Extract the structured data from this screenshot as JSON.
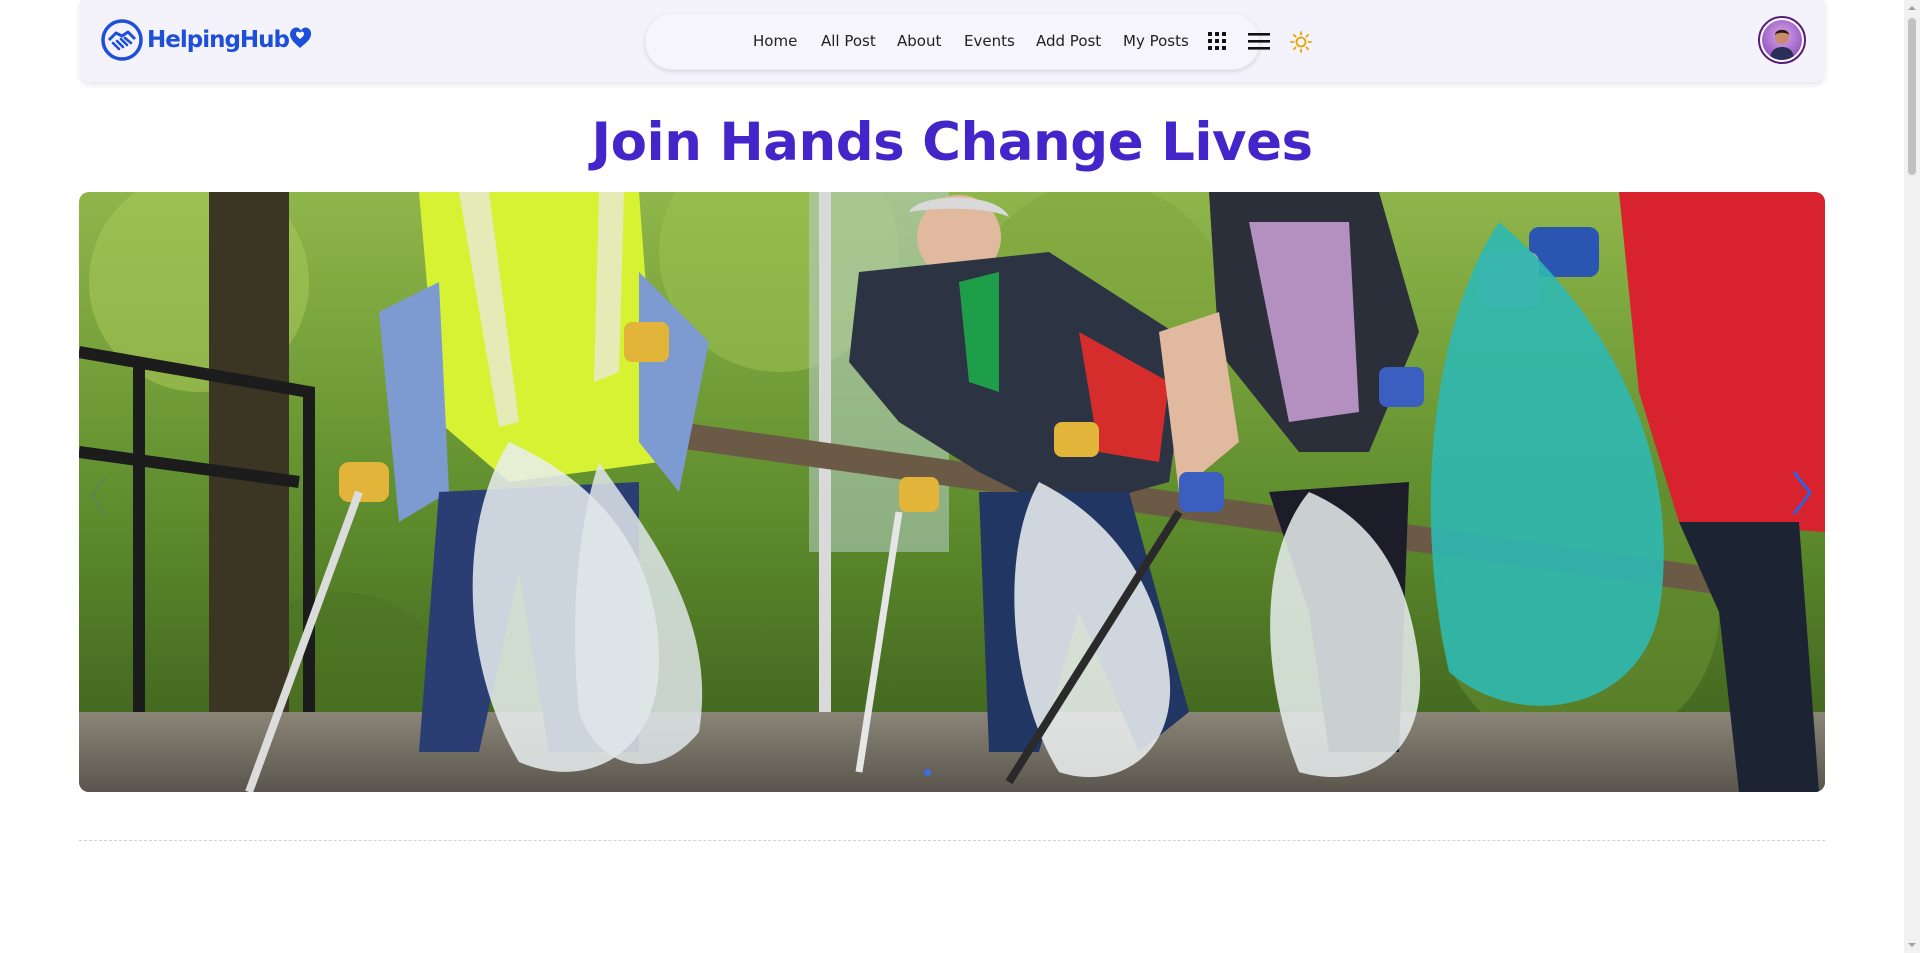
{
  "brand": {
    "name": "HelpingHub",
    "color": "#1d4fd8"
  },
  "nav": {
    "links": [
      {
        "label": "Home"
      },
      {
        "label": "All Post"
      },
      {
        "label": "About"
      },
      {
        "label": "Events"
      },
      {
        "label": "Add Post"
      },
      {
        "label": "My Posts"
      }
    ],
    "icons": [
      "grid-icon",
      "hamburger-menu-icon",
      "sun-icon"
    ]
  },
  "user": {
    "avatar_icon": "user-avatar-icon"
  },
  "hero": {
    "title": "Join Hands Change Lives",
    "title_color": "#4326c9"
  },
  "carousel": {
    "slide_count": 1,
    "active_index": 0,
    "image_subject": "volunteers picking up litter",
    "prev_icon": "chevron-left-icon",
    "next_icon": "chevron-right-icon",
    "arrow_color": "#2b63e8"
  }
}
